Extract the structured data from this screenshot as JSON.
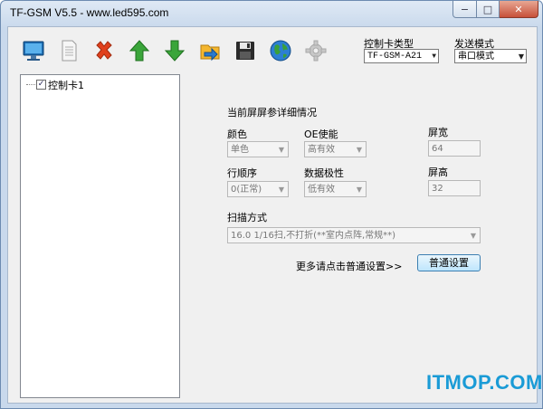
{
  "window": {
    "title": "TF-GSM V5.5 - www.led595.com",
    "minimize": "−",
    "maximize": "□",
    "close": "✕"
  },
  "toolbar": {
    "icons": [
      "computer-icon",
      "document-icon",
      "delete-icon",
      "up-arrow-icon",
      "down-arrow-icon",
      "send-icon",
      "save-icon",
      "globe-icon",
      "gear-icon"
    ]
  },
  "header": {
    "controller_type_label": "控制卡类型",
    "controller_type_value": "TF-GSM-A21",
    "send_mode_label": "发送模式",
    "send_mode_value": "串口模式"
  },
  "tree": {
    "items": [
      {
        "label": "控制卡1",
        "checked": true
      }
    ],
    "check_mark": "✓"
  },
  "details": {
    "section_title": "当前屏屏参详细情况",
    "color_label": "颜色",
    "color_value": "单色",
    "oe_label": "OE使能",
    "oe_value": "高有效",
    "width_label": "屏宽",
    "width_value": "64",
    "row_order_label": "行顺序",
    "row_order_value": "0(正常)",
    "data_polarity_label": "数据极性",
    "data_polarity_value": "低有效",
    "height_label": "屏高",
    "height_value": "32",
    "scan_label": "扫描方式",
    "scan_value": "16.0  1/16扫,不打折(**室内点阵,常规**)",
    "more_text": "更多请点击普通设置>>",
    "settings_button": "普通设置"
  },
  "watermark": "ITMOP.COM",
  "colors": {
    "watermark": "#1a9bd6",
    "title_bar": "#c9d9ec"
  }
}
